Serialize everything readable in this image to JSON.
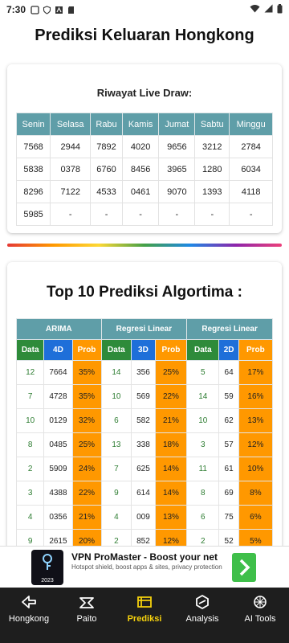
{
  "status_bar": {
    "time": "7:30"
  },
  "app": {
    "title": "Prediksi Keluaran Hongkong"
  },
  "history": {
    "title": "Riwayat Live Draw:",
    "columns": [
      "Senin",
      "Selasa",
      "Rabu",
      "Kamis",
      "Jumat",
      "Sabtu",
      "Minggu"
    ],
    "rows": [
      [
        "7568",
        "2944",
        "7892",
        "4020",
        "9656",
        "3212",
        "2784"
      ],
      [
        "5838",
        "0378",
        "6760",
        "8456",
        "3965",
        "1280",
        "6034"
      ],
      [
        "8296",
        "7122",
        "4533",
        "0461",
        "9070",
        "1393",
        "4118"
      ],
      [
        "5985",
        "-",
        "-",
        "-",
        "-",
        "-",
        "-"
      ]
    ]
  },
  "prediction": {
    "title": "Top 10 Prediksi Algortima :",
    "groups": [
      {
        "name": "ARIMA",
        "sub": [
          "Data",
          "4D",
          "Prob"
        ]
      },
      {
        "name": "Regresi Linear",
        "sub": [
          "Data",
          "3D",
          "Prob"
        ]
      },
      {
        "name": "Regresi Linear",
        "sub": [
          "Data",
          "2D",
          "Prob"
        ]
      }
    ],
    "rows": [
      [
        "12",
        "7664",
        "35%",
        "14",
        "356",
        "25%",
        "5",
        "64",
        "17%"
      ],
      [
        "7",
        "4728",
        "35%",
        "10",
        "569",
        "22%",
        "14",
        "59",
        "16%"
      ],
      [
        "10",
        "0129",
        "32%",
        "6",
        "582",
        "21%",
        "10",
        "62",
        "13%"
      ],
      [
        "8",
        "0485",
        "25%",
        "13",
        "338",
        "18%",
        "3",
        "57",
        "12%"
      ],
      [
        "2",
        "5909",
        "24%",
        "7",
        "625",
        "14%",
        "11",
        "61",
        "10%"
      ],
      [
        "3",
        "4388",
        "22%",
        "9",
        "614",
        "14%",
        "8",
        "69",
        "8%"
      ],
      [
        "4",
        "0356",
        "21%",
        "4",
        "009",
        "13%",
        "6",
        "75",
        "6%"
      ],
      [
        "9",
        "2615",
        "20%",
        "2",
        "852",
        "12%",
        "2",
        "52",
        "5%"
      ]
    ]
  },
  "ad": {
    "title": "VPN ProMaster - Boost your net",
    "description": "Hotspot shield, boost apps & sites, privacy protection",
    "logo_year": "2023"
  },
  "nav": {
    "items": [
      {
        "label": "Hongkong",
        "icon": "hongkong-icon",
        "active": false
      },
      {
        "label": "Paito",
        "icon": "paito-icon",
        "active": false
      },
      {
        "label": "Prediksi",
        "icon": "prediksi-icon",
        "active": true
      },
      {
        "label": "Analysis",
        "icon": "analysis-icon",
        "active": false
      },
      {
        "label": "AI Tools",
        "icon": "ai-tools-icon",
        "active": false
      }
    ]
  },
  "colors": {
    "header_teal": "#5f9ea8",
    "data_green": "#2e8b3a",
    "num_blue": "#1e6fd9",
    "prob_orange": "#ff9800",
    "nav_bg": "#1e1e1e",
    "nav_active": "#f5d10d"
  }
}
